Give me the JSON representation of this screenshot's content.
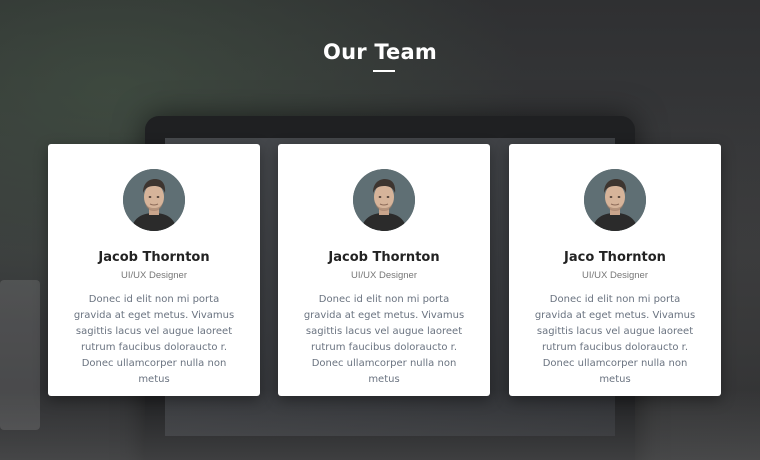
{
  "section": {
    "title": "Our Team"
  },
  "members": [
    {
      "name": "Jacob Thornton",
      "role": "UI/UX Designer",
      "description": "Donec id elit non mi porta gravida at eget metus. Vivamus sagittis lacus vel augue laoreet rutrum faucibus doloraucto r. Donec ullamcorper nulla non metus"
    },
    {
      "name": "Jacob Thornton",
      "role": "UI/UX Designer",
      "description": "Donec id elit non mi porta gravida at eget metus. Vivamus sagittis lacus vel augue laoreet rutrum faucibus doloraucto r. Donec ullamcorper nulla non metus"
    },
    {
      "name": "Jaco Thornton",
      "role": "UI/UX Designer",
      "description": "Donec id elit non mi porta gravida at eget metus. Vivamus sagittis lacus vel augue laoreet rutrum faucibus doloraucto r. Donec ullamcorper nulla non metus"
    }
  ],
  "colors": {
    "card_background": "#ffffff",
    "title_text": "#ffffff",
    "name_text": "#222222",
    "description_text": "#6a7380"
  },
  "icons": {
    "avatar": "person-portrait-icon"
  }
}
